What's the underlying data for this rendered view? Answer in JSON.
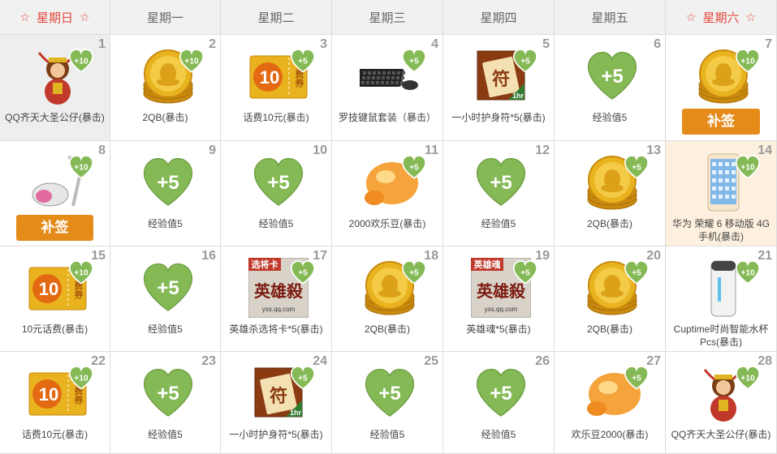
{
  "headers": [
    {
      "label": "星期日",
      "weekend": true
    },
    {
      "label": "星期一",
      "weekend": false
    },
    {
      "label": "星期二",
      "weekend": false
    },
    {
      "label": "星期三",
      "weekend": false
    },
    {
      "label": "星期四",
      "weekend": false
    },
    {
      "label": "星期五",
      "weekend": false
    },
    {
      "label": "星期六",
      "weekend": true
    }
  ],
  "header_star": "☆",
  "cells": [
    {
      "day": "1",
      "label": "QQ齐天大圣公仔(暴击)",
      "icon": "monkey-king-doll-icon",
      "badge": "+10",
      "state": "past"
    },
    {
      "day": "2",
      "label": "2QB(暴击)",
      "icon": "qq-coin-icon",
      "badge": "+10"
    },
    {
      "day": "3",
      "label": "话费10元(暴击)",
      "icon": "phone-credit-ticket-icon",
      "ticket_value": "10",
      "ticket_text": "话费券",
      "badge": "+5"
    },
    {
      "day": "4",
      "label": "罗技键鼠套装（暴击）",
      "icon": "keyboard-mouse-icon",
      "badge": "+5"
    },
    {
      "day": "5",
      "label": "一小时护身符*5(暴击)",
      "icon": "amulet-icon",
      "amulet_text": "符",
      "amulet_tag": "1hr",
      "badge": "+5"
    },
    {
      "day": "6",
      "label": "经验值5",
      "icon": "exp-heart-icon",
      "heart_text": "+5"
    },
    {
      "day": "7",
      "label": "",
      "icon": "qq-coin-icon",
      "badge": "+10",
      "button": "补签"
    },
    {
      "day": "8",
      "label": "",
      "icon": "vacuum-cleaner-icon",
      "badge": "+10",
      "button": "补签"
    },
    {
      "day": "9",
      "label": "经验值5",
      "icon": "exp-heart-icon",
      "heart_text": "+5"
    },
    {
      "day": "10",
      "label": "经验值5",
      "icon": "exp-heart-icon",
      "heart_text": "+5"
    },
    {
      "day": "11",
      "label": "2000欢乐豆(暴击)",
      "icon": "happy-bean-icon",
      "badge": "+5"
    },
    {
      "day": "12",
      "label": "经验值5",
      "icon": "exp-heart-icon",
      "heart_text": "+5"
    },
    {
      "day": "13",
      "label": "2QB(暴击)",
      "icon": "qq-coin-icon",
      "badge": "+5"
    },
    {
      "day": "14",
      "label": "华为 荣耀 6 移动版 4G手机(暴击)",
      "icon": "smartphone-icon",
      "badge": "+10",
      "state": "highlight"
    },
    {
      "day": "15",
      "label": "10元话费(暴击)",
      "icon": "phone-credit-ticket-icon",
      "ticket_value": "10",
      "ticket_text": "话费券",
      "badge": "+10"
    },
    {
      "day": "16",
      "label": "经验值5",
      "icon": "exp-heart-icon",
      "heart_text": "+5"
    },
    {
      "day": "17",
      "label": "英雄杀选将卡*5(暴击)",
      "icon": "hero-card-icon",
      "card_tag": "选将卡",
      "card_title": "英雄殺",
      "card_site": "yxs.qq.com",
      "badge": "+5"
    },
    {
      "day": "18",
      "label": "2QB(暴击)",
      "icon": "qq-coin-icon",
      "badge": "+5"
    },
    {
      "day": "19",
      "label": "英雄魂*5(暴击)",
      "icon": "hero-soul-icon",
      "card_tag": "英雄魂",
      "card_title": "英雄殺",
      "card_site": "yxs.qq.com",
      "badge": "+5"
    },
    {
      "day": "20",
      "label": "2QB(暴击)",
      "icon": "qq-coin-icon",
      "badge": "+5"
    },
    {
      "day": "21",
      "label": "Cuptime时尚智能水杯 Pcs(暴击)",
      "icon": "smart-cup-icon",
      "badge": "+10"
    },
    {
      "day": "22",
      "label": "话费10元(暴击)",
      "icon": "phone-credit-ticket-icon",
      "ticket_value": "10",
      "ticket_text": "话费券",
      "badge": "+10"
    },
    {
      "day": "23",
      "label": "经验值5",
      "icon": "exp-heart-icon",
      "heart_text": "+5"
    },
    {
      "day": "24",
      "label": "一小时护身符*5(暴击)",
      "icon": "amulet-icon",
      "amulet_text": "符",
      "amulet_tag": "1hr",
      "badge": "+5"
    },
    {
      "day": "25",
      "label": "经验值5",
      "icon": "exp-heart-icon",
      "heart_text": "+5"
    },
    {
      "day": "26",
      "label": "经验值5",
      "icon": "exp-heart-icon",
      "heart_text": "+5"
    },
    {
      "day": "27",
      "label": "欢乐豆2000(暴击)",
      "icon": "happy-bean-icon",
      "badge": "+5"
    },
    {
      "day": "28",
      "label": "QQ齐天大圣公仔(暴击)",
      "icon": "monkey-king-doll-icon",
      "badge": "+10"
    }
  ],
  "colors": {
    "heart_green": "#84b955",
    "weekend_red": "#e3493b",
    "button_orange": "#e48b1a",
    "gold": "#e9b31f",
    "highlight_bg": "#fdf0de",
    "past_bg": "#eeeeee"
  }
}
